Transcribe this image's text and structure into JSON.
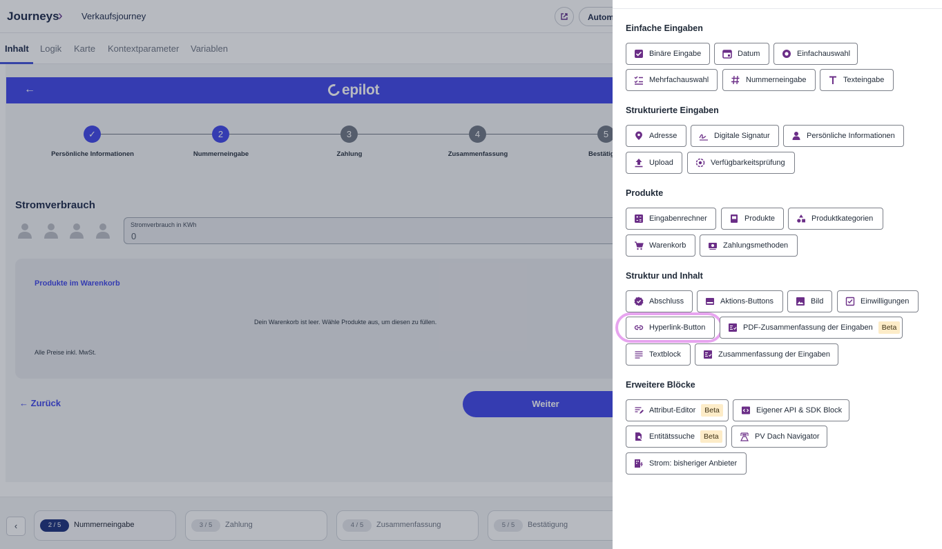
{
  "editor": {
    "breadcrumb": {
      "root": "Journeys",
      "current": "Verkaufsjourney"
    },
    "automation_label": "Automa",
    "tabs": [
      "Inhalt",
      "Logik",
      "Karte",
      "Kontextparameter",
      "Variablen"
    ],
    "active_tab": "Inhalt",
    "brand": "epilot",
    "steps": [
      {
        "number": "✓",
        "label": "Persönliche Informationen",
        "state": "done"
      },
      {
        "number": "2",
        "label": "Nummerneingabe",
        "state": "active"
      },
      {
        "number": "3",
        "label": "Zahlung",
        "state": "pending"
      },
      {
        "number": "4",
        "label": "Zusammenfassung",
        "state": "pending"
      },
      {
        "number": "5",
        "label": "Bestätig",
        "state": "pending"
      }
    ],
    "section_title": "Stromverbrauch",
    "kwh_field": {
      "label": "Stromverbrauch in KWh",
      "value": "0"
    },
    "cart": {
      "title": "Produkte im Warenkorb",
      "empty_message": "Dein Warenkorb ist leer. Wähle Produkte aus, um diesen zu füllen.",
      "vat_note": "Alle Preise inkl. MwSt."
    },
    "back_label": "Zurück",
    "next_label": "Weiter",
    "bottom_steps": [
      {
        "pill": "2 / 5",
        "name": "Nummerneingabe",
        "current": true
      },
      {
        "pill": "3 / 5",
        "name": "Zahlung",
        "current": false
      },
      {
        "pill": "4 / 5",
        "name": "Zusammenfassung",
        "current": false
      },
      {
        "pill": "5 / 5",
        "name": "Bestätigung",
        "current": false
      }
    ]
  },
  "panel": {
    "categories": [
      {
        "title": "Einfache Eingaben",
        "blocks": [
          {
            "label": "Binäre Eingabe",
            "icon": "checkbox-icon"
          },
          {
            "label": "Datum",
            "icon": "calendar-icon"
          },
          {
            "label": "Einfachauswahl",
            "icon": "radio-icon"
          },
          {
            "label": "Mehrfachauswahl",
            "icon": "checklist-icon"
          },
          {
            "label": "Nummerneingabe",
            "icon": "hash-icon"
          },
          {
            "label": "Texteingabe",
            "icon": "text-icon"
          }
        ]
      },
      {
        "title": "Strukturierte Eingaben",
        "blocks": [
          {
            "label": "Adresse",
            "icon": "location-pin-icon"
          },
          {
            "label": "Digitale Signatur",
            "icon": "signature-icon"
          },
          {
            "label": "Persönliche Informationen",
            "icon": "person-icon"
          },
          {
            "label": "Upload",
            "icon": "upload-icon"
          },
          {
            "label": "Verfügbarkeitsprüfung",
            "icon": "availability-check-icon"
          }
        ]
      },
      {
        "title": "Produkte",
        "blocks": [
          {
            "label": "Eingabenrechner",
            "icon": "calculator-icon"
          },
          {
            "label": "Produkte",
            "icon": "product-box-icon"
          },
          {
            "label": "Produktkategorien",
            "icon": "categories-icon"
          },
          {
            "label": "Warenkorb",
            "icon": "cart-icon"
          },
          {
            "label": "Zahlungsmethoden",
            "icon": "payment-icon"
          }
        ]
      },
      {
        "title": "Struktur und Inhalt",
        "blocks": [
          {
            "label": "Abschluss",
            "icon": "badge-check-icon"
          },
          {
            "label": "Aktions-Buttons",
            "icon": "action-buttons-icon"
          },
          {
            "label": "Bild",
            "icon": "image-icon"
          },
          {
            "label": "Einwilligungen",
            "icon": "consent-icon"
          },
          {
            "label": "Hyperlink-Button",
            "icon": "link-icon",
            "highlighted": true
          },
          {
            "label": "PDF-Zusammenfassung der Eingaben",
            "icon": "summary-icon",
            "badge": "Beta"
          },
          {
            "label": "Textblock",
            "icon": "lines-icon"
          },
          {
            "label": "Zusammenfassung der Eingaben",
            "icon": "summary-icon"
          }
        ]
      },
      {
        "title": "Erweitere Blöcke",
        "blocks": [
          {
            "label": "Attribut-Editor",
            "icon": "edit-lines-icon",
            "badge": "Beta"
          },
          {
            "label": "Eigener API & SDK Block",
            "icon": "code-icon"
          },
          {
            "label": "Entitätssuche",
            "icon": "doc-search-icon",
            "badge": "Beta"
          },
          {
            "label": "PV Dach Navigator",
            "icon": "solar-panel-icon"
          },
          {
            "label": "Strom: bisheriger Anbieter",
            "icon": "power-provider-icon"
          }
        ]
      }
    ]
  },
  "colors": {
    "brand_blue": "#3a40e8",
    "icon_purple": "#6b2e87",
    "highlight_ring": "#e7a4ef",
    "beta_badge": "#fdecc8",
    "step_done": "#3a40e8",
    "step_pending": "#6b7280"
  }
}
